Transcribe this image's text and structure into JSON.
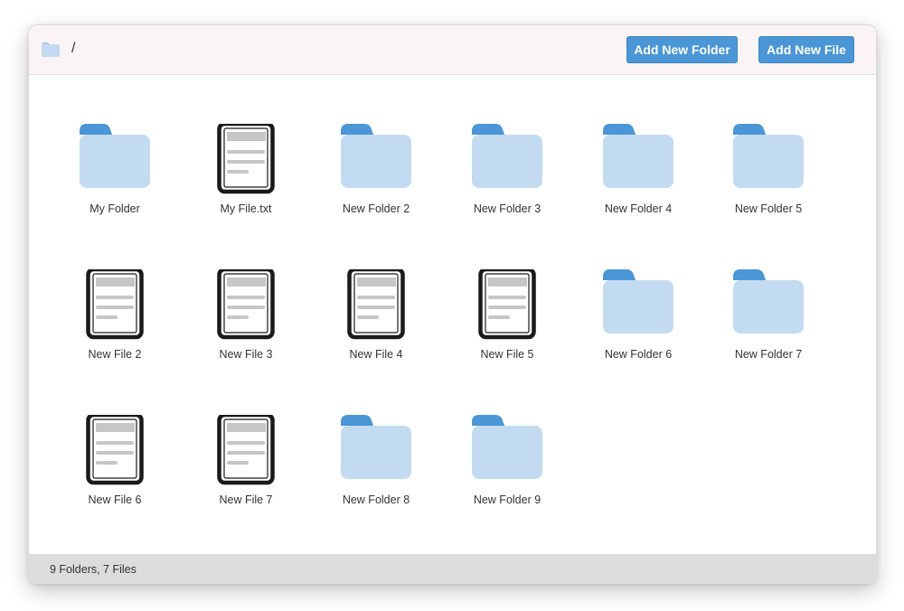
{
  "header": {
    "path": "/",
    "add_folder_label": "Add New Folder",
    "add_file_label": "Add New File"
  },
  "items": [
    {
      "type": "folder",
      "name": "My Folder"
    },
    {
      "type": "file",
      "name": "My File.txt"
    },
    {
      "type": "folder",
      "name": "New Folder 2"
    },
    {
      "type": "folder",
      "name": "New Folder 3"
    },
    {
      "type": "folder",
      "name": "New Folder 4"
    },
    {
      "type": "folder",
      "name": "New Folder 5"
    },
    {
      "type": "file",
      "name": "New File 2"
    },
    {
      "type": "file",
      "name": "New File 3"
    },
    {
      "type": "file",
      "name": "New File 4"
    },
    {
      "type": "file",
      "name": "New File 5"
    },
    {
      "type": "folder",
      "name": "New Folder 6"
    },
    {
      "type": "folder",
      "name": "New Folder 7"
    },
    {
      "type": "file",
      "name": "New File 6"
    },
    {
      "type": "file",
      "name": "New File 7"
    },
    {
      "type": "folder",
      "name": "New Folder 8"
    },
    {
      "type": "folder",
      "name": "New Folder 9"
    }
  ],
  "status": {
    "summary": "9 Folders, 7 Files"
  },
  "colors": {
    "accent": "#4a96d6",
    "folder_body": "#c3dbf1",
    "folder_tab": "#4a96d6",
    "status_bar": "#dcdcdc",
    "header_bg": "#faf4f6"
  }
}
